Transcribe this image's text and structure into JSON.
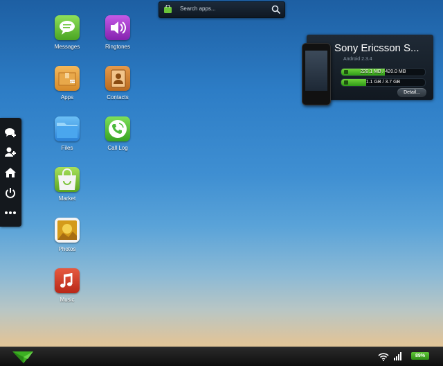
{
  "search": {
    "placeholder": "Search apps..."
  },
  "apps": [
    {
      "label": "Messages",
      "icon": "messages-icon",
      "color": "#6ac43a"
    },
    {
      "label": "Ringtones",
      "icon": "ringtones-icon",
      "color": "#a238c8"
    },
    {
      "label": "Apps",
      "icon": "apps-icon",
      "color": "#e49a3a"
    },
    {
      "label": "Contacts",
      "icon": "contacts-icon",
      "color": "#c87a2a"
    },
    {
      "label": "Files",
      "icon": "files-icon",
      "color": "#4aa0e6"
    },
    {
      "label": "Call Log",
      "icon": "call-log-icon",
      "color": "#4cba3c"
    },
    {
      "label": "Market",
      "icon": "market-icon",
      "color": "#7cc43a"
    },
    {
      "label": "Photos",
      "icon": "photos-icon",
      "color": "#d4a020"
    },
    {
      "label": "Music",
      "icon": "music-icon",
      "color": "#d43a28"
    }
  ],
  "sidebar": {
    "items": [
      {
        "icon": "new-message-icon"
      },
      {
        "icon": "add-contact-icon"
      },
      {
        "icon": "home-icon"
      },
      {
        "icon": "power-icon"
      },
      {
        "icon": "more-icon"
      }
    ]
  },
  "device": {
    "name": "Sony Ericsson S...",
    "version": "Android 2.3.4",
    "storage": [
      {
        "text": "220.1 MB / 420.0 MB",
        "fraction": 0.524,
        "icon": "phone-memory-icon"
      },
      {
        "text": "1.1 GB / 3.7 GB",
        "fraction": 0.297,
        "icon": "sd-card-icon"
      }
    ],
    "detail_label": "Detail..."
  },
  "taskbar": {
    "battery": "89%",
    "colors": {
      "accent": "#3cb022"
    }
  }
}
